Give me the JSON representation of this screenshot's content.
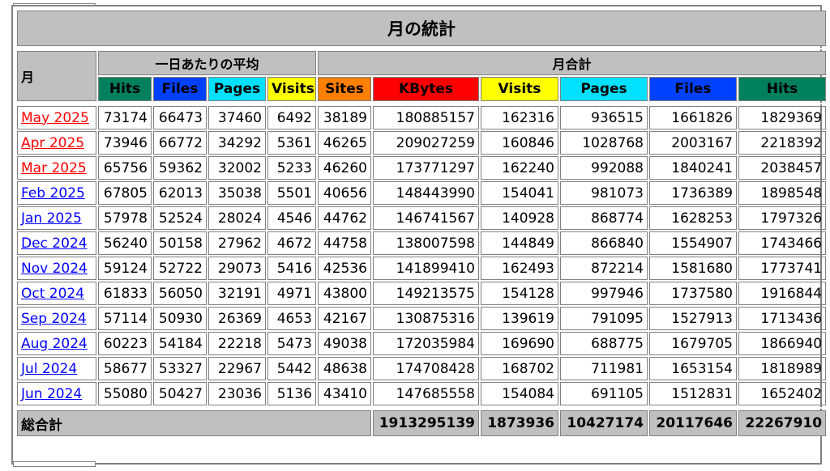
{
  "title": "月の統計",
  "month_header": "月",
  "group_avg": "一日あたりの平均",
  "group_total": "月合計",
  "avg_columns": [
    {
      "label": "Hits",
      "cls": "c-hits"
    },
    {
      "label": "Files",
      "cls": "c-files"
    },
    {
      "label": "Pages",
      "cls": "c-pages"
    },
    {
      "label": "Visits",
      "cls": "c-visits"
    }
  ],
  "total_columns": [
    {
      "label": "Sites",
      "cls": "c-sites"
    },
    {
      "label": "KBytes",
      "cls": "c-kbytes"
    },
    {
      "label": "Visits",
      "cls": "c-visits"
    },
    {
      "label": "Pages",
      "cls": "c-pages"
    },
    {
      "label": "Files",
      "cls": "c-files"
    },
    {
      "label": "Hits",
      "cls": "c-hits"
    }
  ],
  "rows": [
    {
      "month": "May 2025",
      "link_color": "red",
      "avg": [
        "73174",
        "66473",
        "37460",
        "6492"
      ],
      "tot": [
        "38189",
        "180885157",
        "162316",
        "936515",
        "1661826",
        "1829369"
      ]
    },
    {
      "month": "Apr 2025",
      "link_color": "red",
      "avg": [
        "73946",
        "66772",
        "34292",
        "5361"
      ],
      "tot": [
        "46265",
        "209027259",
        "160846",
        "1028768",
        "2003167",
        "2218392"
      ]
    },
    {
      "month": "Mar 2025",
      "link_color": "red",
      "avg": [
        "65756",
        "59362",
        "32002",
        "5233"
      ],
      "tot": [
        "46260",
        "173771297",
        "162240",
        "992088",
        "1840241",
        "2038457"
      ]
    },
    {
      "month": "Feb 2025",
      "link_color": "blue",
      "avg": [
        "67805",
        "62013",
        "35038",
        "5501"
      ],
      "tot": [
        "40656",
        "148443990",
        "154041",
        "981073",
        "1736389",
        "1898548"
      ]
    },
    {
      "month": "Jan 2025",
      "link_color": "blue",
      "avg": [
        "57978",
        "52524",
        "28024",
        "4546"
      ],
      "tot": [
        "44762",
        "146741567",
        "140928",
        "868774",
        "1628253",
        "1797326"
      ]
    },
    {
      "month": "Dec 2024",
      "link_color": "blue",
      "avg": [
        "56240",
        "50158",
        "27962",
        "4672"
      ],
      "tot": [
        "44758",
        "138007598",
        "144849",
        "866840",
        "1554907",
        "1743466"
      ]
    },
    {
      "month": "Nov 2024",
      "link_color": "blue",
      "avg": [
        "59124",
        "52722",
        "29073",
        "5416"
      ],
      "tot": [
        "42536",
        "141899410",
        "162493",
        "872214",
        "1581680",
        "1773741"
      ]
    },
    {
      "month": "Oct 2024",
      "link_color": "blue",
      "avg": [
        "61833",
        "56050",
        "32191",
        "4971"
      ],
      "tot": [
        "43800",
        "149213575",
        "154128",
        "997946",
        "1737580",
        "1916844"
      ]
    },
    {
      "month": "Sep 2024",
      "link_color": "blue",
      "avg": [
        "57114",
        "50930",
        "26369",
        "4653"
      ],
      "tot": [
        "42167",
        "130875316",
        "139619",
        "791095",
        "1527913",
        "1713436"
      ]
    },
    {
      "month": "Aug 2024",
      "link_color": "blue",
      "avg": [
        "60223",
        "54184",
        "22218",
        "5473"
      ],
      "tot": [
        "49038",
        "172035984",
        "169690",
        "688775",
        "1679705",
        "1866940"
      ]
    },
    {
      "month": "Jul 2024",
      "link_color": "blue",
      "avg": [
        "58677",
        "53327",
        "22967",
        "5442"
      ],
      "tot": [
        "48638",
        "174708428",
        "168702",
        "711981",
        "1653154",
        "1818989"
      ]
    },
    {
      "month": "Jun 2024",
      "link_color": "blue",
      "avg": [
        "55080",
        "50427",
        "23036",
        "5136"
      ],
      "tot": [
        "43410",
        "147685558",
        "154084",
        "691105",
        "1512831",
        "1652402"
      ]
    }
  ],
  "totals": {
    "label": "総合計",
    "kbytes": "1913295139",
    "visits": "1873936",
    "pages": "10427174",
    "files": "20117646",
    "hits": "22267910"
  }
}
